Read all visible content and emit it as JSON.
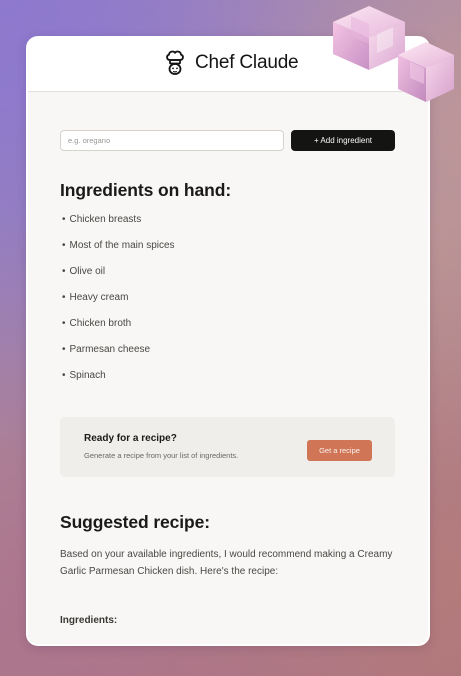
{
  "app": {
    "title": "Chef Claude"
  },
  "form": {
    "input_placeholder": "e.g. oregano",
    "input_value": "",
    "add_button_label": "+ Add ingredient"
  },
  "ingredients": {
    "heading": "Ingredients on hand:",
    "bullet": "•",
    "items": [
      "Chicken breasts",
      "Most of the main spices",
      "Olive oil",
      "Heavy cream",
      "Chicken broth",
      "Parmesan cheese",
      "Spinach"
    ]
  },
  "cta": {
    "title": "Ready for a recipe?",
    "subtitle": "Generate a recipe from your list of ingredients.",
    "button_label": "Get a recipe"
  },
  "recipe": {
    "heading": "Suggested recipe:",
    "intro": "Based on your available ingredients, I would recommend making a Creamy Garlic Parmesan Chicken dish. Here's the recipe:",
    "ingredients_heading": "Ingredients:"
  },
  "icons": {
    "logo": "chef-hat-icon",
    "decoration": "cube-icon"
  },
  "colors": {
    "accent": "#d17557",
    "dark_button": "#141413",
    "card_background": "#f8f7f5",
    "cta_background": "#f0eeea"
  }
}
